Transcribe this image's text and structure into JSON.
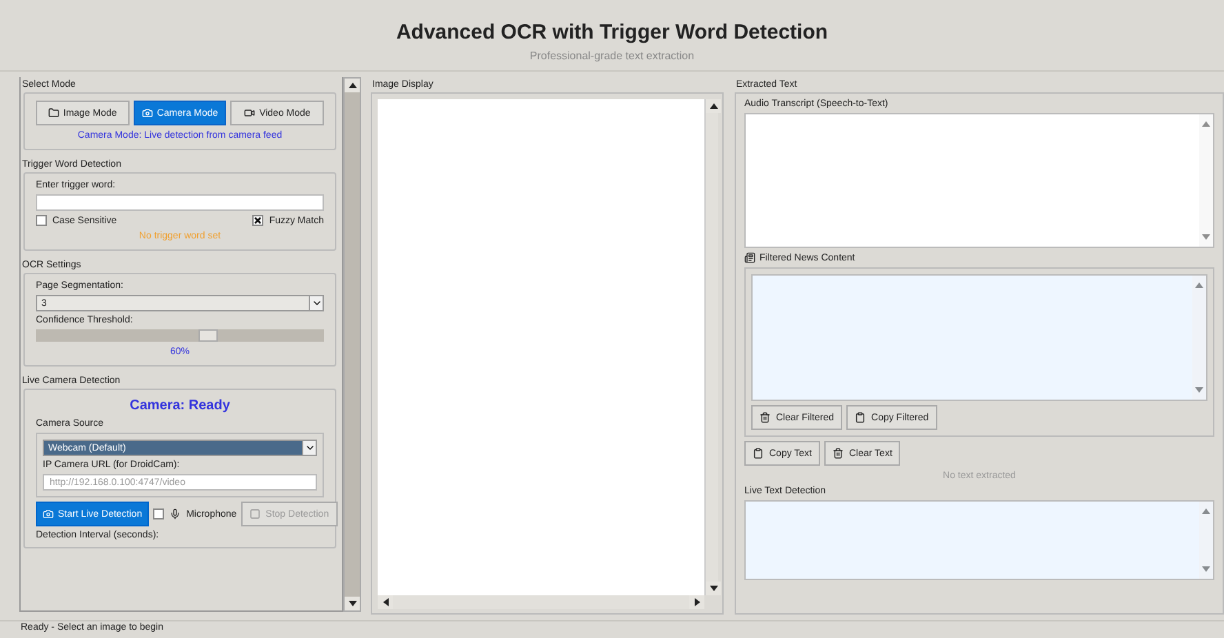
{
  "header": {
    "title": "Advanced OCR with Trigger Word Detection",
    "subtitle": "Professional-grade text extraction"
  },
  "select_mode": {
    "label": "Select Mode",
    "modes": [
      {
        "label": "Image Mode",
        "selected": false
      },
      {
        "label": "Camera Mode",
        "selected": true
      },
      {
        "label": "Video Mode",
        "selected": false
      }
    ],
    "caption": "Camera Mode: Live detection from camera feed"
  },
  "trigger": {
    "label": "Trigger Word Detection",
    "field_label": "Enter trigger word:",
    "options": [
      {
        "label": "Case Sensitive",
        "checked": false
      },
      {
        "label": "Fuzzy Match",
        "checked": true
      }
    ],
    "status": "No trigger word set"
  },
  "ocr": {
    "label": "OCR Settings",
    "segmentation_label": "Page Segmentation:",
    "segmentation_value": "3",
    "confidence_label": "Confidence Threshold:",
    "confidence": {
      "level": 0.6
    },
    "confidence_reading": "60%"
  },
  "camera": {
    "label": "Live Camera Detection",
    "status": "Camera: Ready",
    "source_label": "Camera Source",
    "source_value": "Webcam (Default)",
    "url_label": "IP Camera URL (for DroidCam):",
    "url_placeholder": "http://192.168.0.100:4747/video",
    "start_button": "Start Live Detection",
    "microphone": {
      "label": "Microphone",
      "checked": false
    },
    "stop_button": {
      "label": "Stop Detection",
      "disabled": true
    },
    "interval_label": "Detection Interval (seconds):"
  },
  "image_display": {
    "label": "Image Display"
  },
  "extracted": {
    "label": "Extracted Text",
    "audio_label": "Audio Transcript (Speech-to-Text)",
    "filtered_label": "Filtered News Content",
    "filtered_buttons": [
      {
        "label": "Clear Filtered"
      },
      {
        "label": "Copy Filtered"
      }
    ],
    "buttons": [
      {
        "label": "Copy Text"
      },
      {
        "label": "Clear Text"
      }
    ],
    "status": "No text extracted",
    "live_label": "Live Text Detection"
  },
  "status_bar": "Ready - Select an image to begin"
}
